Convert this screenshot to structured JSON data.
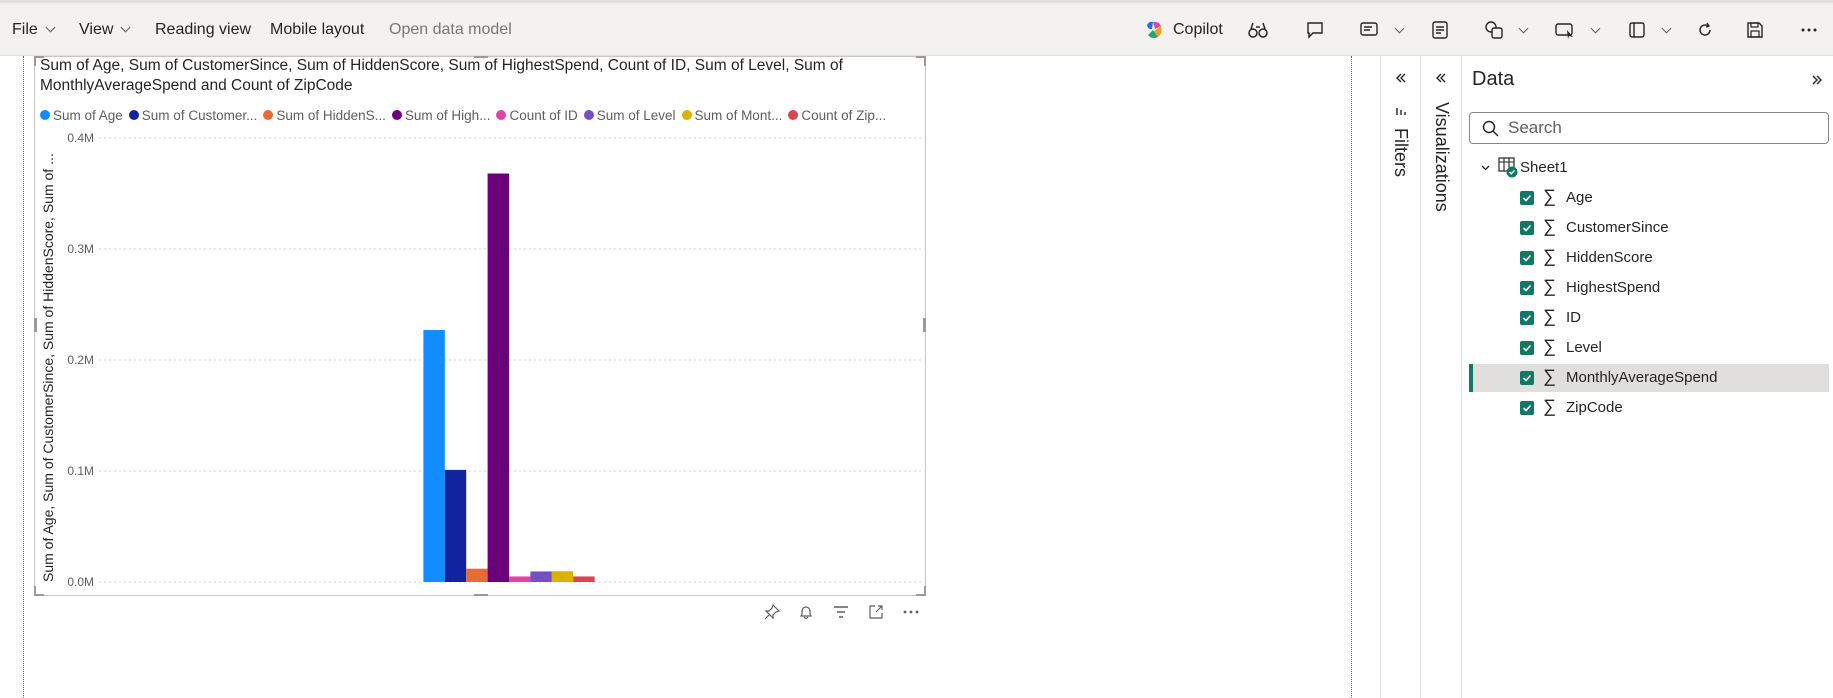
{
  "toolbar": {
    "file": "File",
    "view": "View",
    "reading_view": "Reading view",
    "mobile_layout": "Mobile layout",
    "open_data_model": "Open data model",
    "copilot": "Copilot"
  },
  "visual": {
    "title_line1": "Sum of Age, Sum of CustomerSince, Sum of HiddenScore, Sum of HighestSpend, Count of ID, Sum of Level, Sum of",
    "title_line2": "MonthlyAverageSpend and Count of ZipCode",
    "y_axis_title": "Sum of Age, Sum of CustomerSince, Sum of HiddenScore, Sum of ...",
    "legend": [
      {
        "label": "Sum of Age",
        "color": "#118dff"
      },
      {
        "label": "Sum of Customer...",
        "color": "#12239e"
      },
      {
        "label": "Sum of HiddenS...",
        "color": "#e66c37"
      },
      {
        "label": "Sum of High...",
        "color": "#6b007b"
      },
      {
        "label": "Count of ID",
        "color": "#e044a7"
      },
      {
        "label": "Sum of Level",
        "color": "#744ec2"
      },
      {
        "label": "Sum of Mont...",
        "color": "#d9b300"
      },
      {
        "label": "Count of Zip...",
        "color": "#d64550"
      }
    ]
  },
  "chart_data": {
    "type": "bar",
    "categories": [
      ""
    ],
    "series": [
      {
        "name": "Sum of Age",
        "values": [
          227000
        ],
        "color": "#118dff"
      },
      {
        "name": "Sum of CustomerSince",
        "values": [
          101000
        ],
        "color": "#12239e"
      },
      {
        "name": "Sum of HiddenScore",
        "values": [
          12000
        ],
        "color": "#e66c37"
      },
      {
        "name": "Sum of HighestSpend",
        "values": [
          368000
        ],
        "color": "#6b007b"
      },
      {
        "name": "Count of ID",
        "values": [
          5000
        ],
        "color": "#e044a7"
      },
      {
        "name": "Sum of Level",
        "values": [
          9500
        ],
        "color": "#744ec2"
      },
      {
        "name": "Sum of MonthlyAverageSpend",
        "values": [
          9700
        ],
        "color": "#d9b300"
      },
      {
        "name": "Count of ZipCode",
        "values": [
          5000
        ],
        "color": "#d64550"
      }
    ],
    "ylim": [
      0,
      400000
    ],
    "y_ticks": [
      {
        "value": 0,
        "label": "0.0M"
      },
      {
        "value": 100000,
        "label": "0.1M"
      },
      {
        "value": 200000,
        "label": "0.2M"
      },
      {
        "value": 300000,
        "label": "0.3M"
      },
      {
        "value": 400000,
        "label": "0.4M"
      }
    ],
    "grid": true,
    "legend": "top-left"
  },
  "panes": {
    "filters_label": "Filters",
    "visualizations_label": "Visualizations",
    "data_title": "Data",
    "search_placeholder": "Search",
    "table_name": "Sheet1",
    "fields": [
      {
        "label": "Age",
        "checked": true,
        "selected": false
      },
      {
        "label": "CustomerSince",
        "checked": true,
        "selected": false
      },
      {
        "label": "HiddenScore",
        "checked": true,
        "selected": false
      },
      {
        "label": "HighestSpend",
        "checked": true,
        "selected": false
      },
      {
        "label": "ID",
        "checked": true,
        "selected": false
      },
      {
        "label": "Level",
        "checked": true,
        "selected": false
      },
      {
        "label": "MonthlyAverageSpend",
        "checked": true,
        "selected": true
      },
      {
        "label": "ZipCode",
        "checked": true,
        "selected": false
      }
    ],
    "sigma": "∑"
  }
}
